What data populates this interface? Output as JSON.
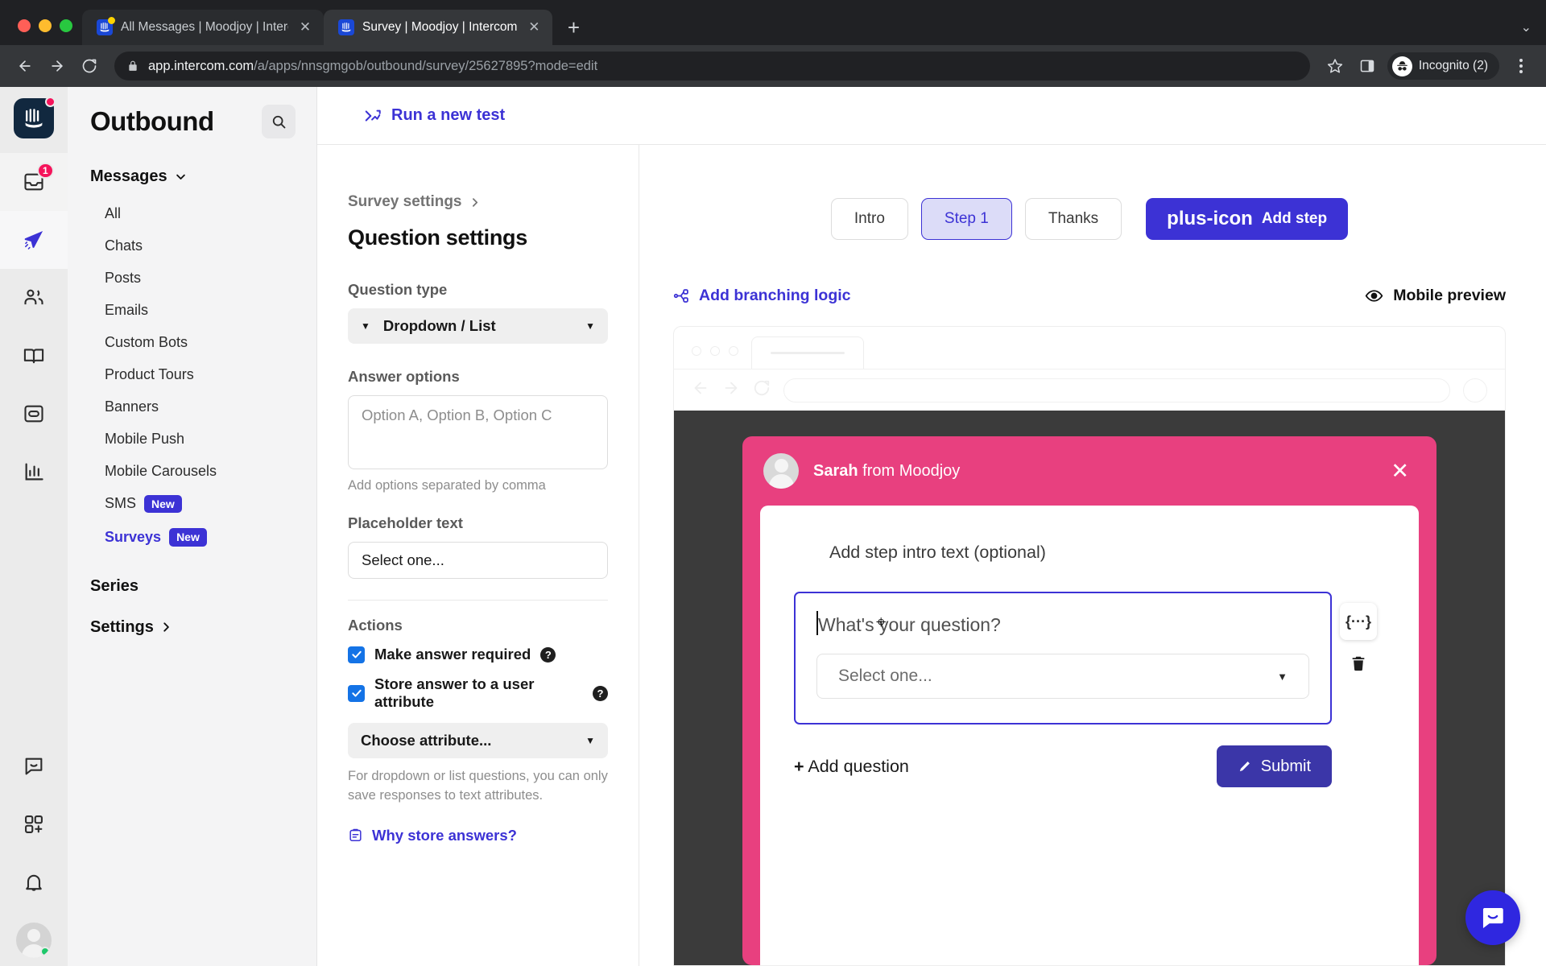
{
  "browser": {
    "tabs": [
      {
        "title": "All Messages | Moodjoy | Interc",
        "active": false,
        "favicon": "intercom-favicon"
      },
      {
        "title": "Survey | Moodjoy | Intercom",
        "active": true,
        "favicon": "intercom-favicon"
      }
    ],
    "new_tab_label": "+",
    "tab_close_label": "✕",
    "tabstrip_menu_label": "⌄",
    "url_prefix": "app.intercom.com",
    "url_path": "/a/apps/nnsgmgob/outbound/survey/25627895?mode=edit",
    "profile_label": "Incognito (2)"
  },
  "rail": {
    "logo_name": "intercom-logo",
    "inbox_badge": "1",
    "items": [
      {
        "name": "inbox",
        "badge": "1"
      },
      {
        "name": "outbound",
        "selected": true
      },
      {
        "name": "contacts"
      },
      {
        "name": "articles"
      },
      {
        "name": "messenger"
      },
      {
        "name": "reports"
      }
    ],
    "bottom_items": [
      {
        "name": "chat"
      },
      {
        "name": "apps"
      },
      {
        "name": "notifications"
      }
    ]
  },
  "outbound_nav": {
    "title": "Outbound",
    "search_icon": "search-icon",
    "group_label": "Messages",
    "items": [
      {
        "label": "All",
        "badge": ""
      },
      {
        "label": "Chats",
        "badge": ""
      },
      {
        "label": "Posts",
        "badge": ""
      },
      {
        "label": "Emails",
        "badge": ""
      },
      {
        "label": "Custom Bots",
        "badge": ""
      },
      {
        "label": "Product Tours",
        "badge": ""
      },
      {
        "label": "Banners",
        "badge": ""
      },
      {
        "label": "Mobile Push",
        "badge": ""
      },
      {
        "label": "Mobile Carousels",
        "badge": ""
      },
      {
        "label": "SMS",
        "badge": "New"
      },
      {
        "label": "Surveys",
        "badge": "New",
        "selected": true
      }
    ],
    "series_label": "Series",
    "settings_label": "Settings"
  },
  "topbar": {
    "run_test_label": "Run a new test",
    "run_test_icon": "ab-test-icon"
  },
  "question_settings": {
    "breadcrumb": "Survey settings",
    "heading": "Question settings",
    "question_type_label": "Question type",
    "question_type_value": "Dropdown / List",
    "answer_options_label": "Answer options",
    "answer_options_placeholder": "Option A, Option B, Option C",
    "answer_options_hint": "Add options separated by comma",
    "placeholder_text_label": "Placeholder text",
    "placeholder_text_value": "Select one...",
    "actions_label": "Actions",
    "checkbox_required_label": "Make answer required",
    "checkbox_store_label": "Store answer to a user attribute",
    "attribute_select_value": "Choose attribute...",
    "attribute_note": "For dropdown or list questions, you can only save responses to text attributes.",
    "why_store_label": "Why store answers?",
    "why_store_icon": "document-icon",
    "help_icon": "question-mark-icon"
  },
  "steps": {
    "tabs": [
      {
        "label": "Intro",
        "active": false
      },
      {
        "label": "Step 1",
        "active": true
      },
      {
        "label": "Thanks",
        "active": false
      }
    ],
    "add_step_label": "Add step",
    "add_step_icon": "plus-icon"
  },
  "preview_bar": {
    "branching_label": "Add branching logic",
    "branching_icon": "branch-icon",
    "mobile_preview_label": "Mobile preview",
    "mobile_preview_icon": "eye-icon"
  },
  "survey_preview": {
    "sender_name": "Sarah",
    "sender_suffix": " from Moodjoy",
    "close_icon": "close-icon",
    "intro_placeholder": "Add step intro text (optional)",
    "question_placeholder": "What's your question?",
    "dropdown_placeholder": "Select one...",
    "variable_button_label": "{···}",
    "delete_icon": "trash-icon",
    "add_question_plus": "+",
    "add_question_label": "Add question",
    "submit_label": "Submit",
    "submit_icon": "pencil-icon",
    "accent_color": "#e8407f",
    "submit_color": "#3b36a8",
    "focus_border_color": "#3c32d5"
  },
  "launcher": {
    "icon": "intercom-messenger-icon"
  },
  "colors": {
    "brand_blue": "#3c32d5",
    "survey_pink": "#e8407f",
    "checkbox_blue": "#1473e6"
  }
}
